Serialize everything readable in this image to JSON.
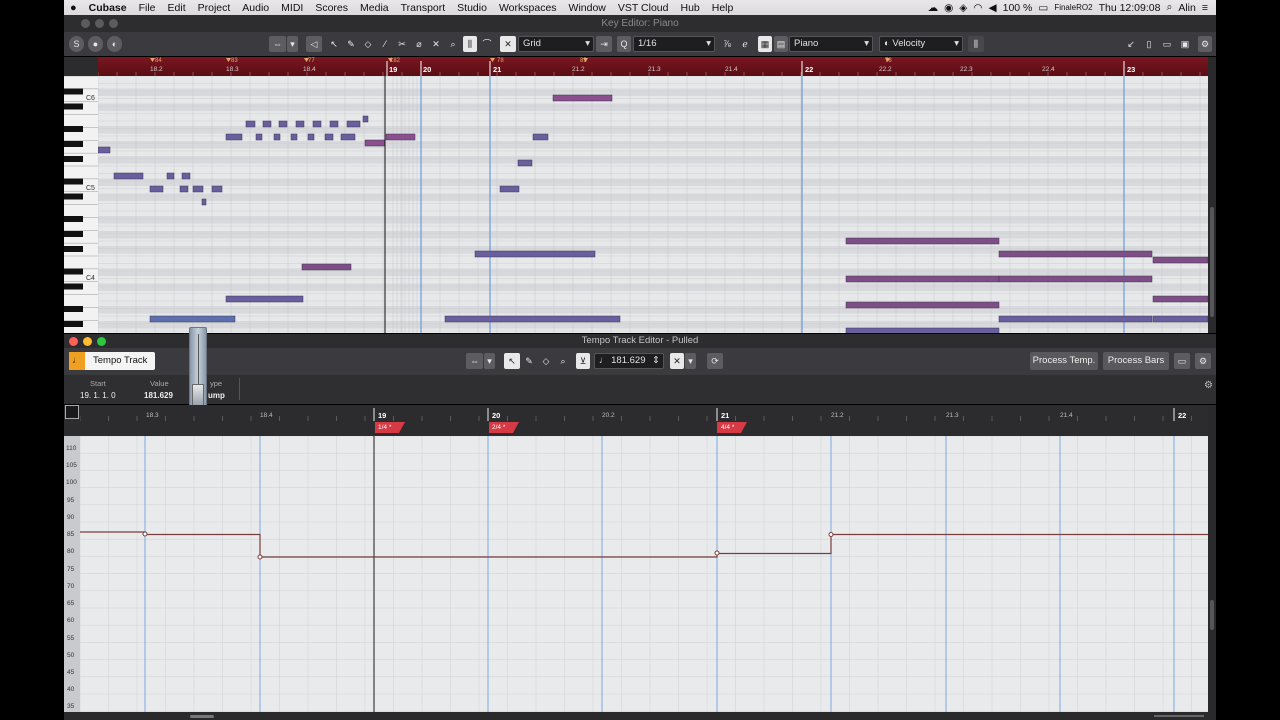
{
  "menubar": {
    "app": "Cubase",
    "items": [
      "File",
      "Edit",
      "Project",
      "Audio",
      "MIDI",
      "Scores",
      "Media",
      "Transport",
      "Studio",
      "Workspaces",
      "Window",
      "VST Cloud",
      "Hub",
      "Help"
    ],
    "battery": "100 %",
    "device": "FinaleRO2",
    "clock": "Thu 12:09:08",
    "user": "Alin"
  },
  "key_editor": {
    "title": "Key Editor: Piano",
    "snap_mode": "Grid",
    "quantize": "1/16",
    "track": "Piano",
    "controller": "Velocity",
    "octave_labels": [
      "C6",
      "C5",
      "C4"
    ],
    "bar_labels": [
      "18.2",
      "18.3",
      "18.4",
      "19",
      "20",
      "21",
      "21.2",
      "21.3",
      "21.4",
      "22",
      "22.2",
      "22.3",
      "22.4",
      "23"
    ],
    "tempo_marks": [
      "84",
      "83",
      "77",
      "182",
      "78",
      "83",
      "78"
    ]
  },
  "tempo_editor": {
    "title": "Tempo Track Editor - Pulled",
    "track_label": "Tempo Track",
    "tempo_value": "181.629",
    "process_tempo_label": "Process Temp.",
    "process_bars_label": "Process Bars",
    "info": {
      "start_header": "Start",
      "value_header": "Value",
      "type_header": "ype",
      "start": "19. 1. 1.  0",
      "value": "181.629",
      "type": "ump"
    },
    "bar_labels": [
      "18.3",
      "18.4",
      "19",
      "20",
      "20.2",
      "21",
      "21.2",
      "21.3",
      "21.4",
      "22"
    ],
    "signatures": [
      "1/4 *",
      "2/4 *",
      "4/4 *"
    ],
    "scale_labels": [
      "110",
      "105",
      "100",
      "95",
      "90",
      "85",
      "80",
      "75",
      "70",
      "65",
      "60",
      "55",
      "50",
      "45",
      "40",
      "35"
    ]
  },
  "colors": {
    "note": "#7a5a9a",
    "note_selected": "#8d4c8a",
    "ruler_red": "#6b1019",
    "tempo_curve": "#7a3d3d",
    "signature_red": "#d63a45"
  }
}
